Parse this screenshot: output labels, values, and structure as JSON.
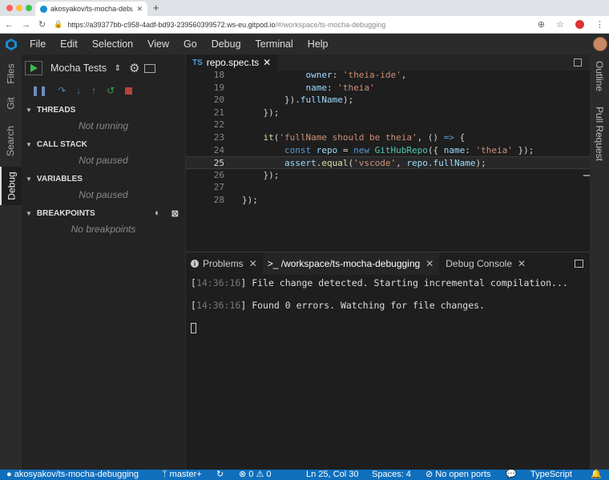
{
  "browser": {
    "tab_title": "akosyakov/ts-mocha-debugging",
    "tab_close": "✕",
    "new_tab": "+",
    "url_main": "https://a39377bb-c958-4adf-bd93-239560399572.ws-eu.gitpod.io",
    "url_path": "/#/workspace/ts-mocha-debugging",
    "traffic": [
      "#fc605c",
      "#fdbc40",
      "#34c84a"
    ]
  },
  "menu": [
    "File",
    "Edit",
    "Selection",
    "View",
    "Go",
    "Debug",
    "Terminal",
    "Help"
  ],
  "activity_left": [
    "Files",
    "Git",
    "Search",
    "Debug"
  ],
  "activity_right": [
    "Outline",
    "Pull Request"
  ],
  "debug": {
    "config": "Mocha Tests",
    "sections": [
      {
        "title": "THREADS",
        "empty": "Not running"
      },
      {
        "title": "CALL STACK",
        "empty": "Not paused"
      },
      {
        "title": "VARIABLES",
        "empty": "Not paused"
      },
      {
        "title": "BREAKPOINTS",
        "empty": "No breakpoints"
      }
    ]
  },
  "editor": {
    "tab": "repo.spec.ts",
    "lines": [
      {
        "n": "18",
        "html": "            <span class='p'>owner</span>: <span class='s'>'theia-ide'</span>,"
      },
      {
        "n": "19",
        "html": "            <span class='p'>name</span>: <span class='s'>'theia'</span>"
      },
      {
        "n": "20",
        "html": "        }).<span class='p'>fullName</span>);"
      },
      {
        "n": "21",
        "html": "    });"
      },
      {
        "n": "22",
        "html": ""
      },
      {
        "n": "23",
        "html": "    <span class='f'>it</span>(<span class='s'>'fullName should be theia'</span>, () <span class='k'>=&gt;</span> {"
      },
      {
        "n": "24",
        "html": "        <span class='k'>const</span> <span class='p'>repo</span> = <span class='k'>new</span> <span class='t'>GitHubRepo</span>({ <span class='p'>name</span>: <span class='s'>'theia'</span> });"
      },
      {
        "n": "25",
        "html": "        <span class='p'>assert</span>.<span class='f'>equal</span>(<span class='s'>'vscode'</span>, <span class='p'>repo</span>.<span class='p'>fullName</span>);"
      },
      {
        "n": "26",
        "html": "    });"
      },
      {
        "n": "27",
        "html": ""
      },
      {
        "n": "28",
        "html": "});"
      }
    ],
    "current_line": "25"
  },
  "panel": {
    "tabs": [
      "Problems",
      ">_ /workspace/ts-mocha-debugging",
      "Debug Console"
    ],
    "terminal": [
      {
        "time": "14:36:16",
        "msg": "File change detected. Starting incremental compilation..."
      },
      {
        "time": "14:36:16",
        "msg": "Found 0 errors. Watching for file changes."
      }
    ]
  },
  "status": {
    "repo": "akosyakov/ts-mocha-debugging",
    "branch": "master+",
    "errors": "0",
    "warnings": "0",
    "position": "Ln 25, Col 30",
    "spaces": "Spaces: 4",
    "ports": "No open ports",
    "language": "TypeScript"
  }
}
